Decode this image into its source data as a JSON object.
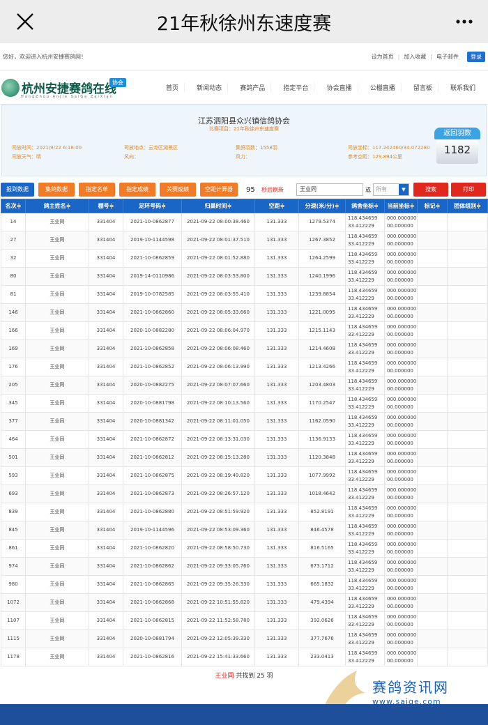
{
  "titlebar": {
    "title": "21年秋徐州东速度赛",
    "close_icon": "close-icon",
    "more_icon": "more-icon"
  },
  "topbar": {
    "greeting": "您好，欢迎进入杭州安捷赛鸽网！",
    "links": [
      "设为首页",
      "加入收藏",
      "电子邮件"
    ],
    "login": "登录"
  },
  "header": {
    "logo_text": "杭州安捷赛鸽在线",
    "logo_badge": "协会",
    "logo_pinyin": "HangZhou AnJie SaiGe ZaiXian",
    "nav": [
      "首页",
      "新闻动态",
      "赛鸽产品",
      "指定平台",
      "协会直播",
      "公棚直播",
      "留言板",
      "联系我们"
    ]
  },
  "panel": {
    "org": "江苏泗阳县众兴镇信鸽协会",
    "project": "比赛项目：21年秋徐州东速度赛",
    "release_time_label": "司放时间：",
    "release_time": "2021/9/22 6:18:00",
    "weather_label": "司放天气：",
    "weather": "晴",
    "location_label": "司放地点：",
    "location": "云龙区湖景区",
    "wind_dir_label": "风向：",
    "wind_dir": "",
    "count_label": "集鸽羽数：",
    "count": "1558羽",
    "wind_label": "风力：",
    "wind": "",
    "coord_label": "司放坐标：",
    "coord": "117.242460/34.072280",
    "dist_label": "参考空距：",
    "dist": "129.894公里",
    "return_label": "返回羽数",
    "return_count": "1182"
  },
  "toolbar": {
    "buttons": [
      "报到数据",
      "集鸽数据",
      "指定名单",
      "指定成绩",
      "关赛成绩",
      "空距计算器"
    ],
    "countdown": "95",
    "refresh": "秒后刷新",
    "search_value": "王业同",
    "or": "或",
    "select_value": "所有",
    "search_button": "搜索",
    "print_button": "打印"
  },
  "table": {
    "headers": [
      "名次",
      "鸽主姓名",
      "棚号",
      "足环号码",
      "归巢时间",
      "空距",
      "分速(米/分)",
      "鸽舍坐标",
      "当前坐标",
      "标记",
      "团体组别"
    ],
    "rows": [
      [
        "14",
        "王业同",
        "331404",
        "2021-10-0862877",
        "2021-09-22 08:00:38.460",
        "131.333",
        "1279.5374"
      ],
      [
        "27",
        "王业同",
        "331404",
        "2019-10-1144598",
        "2021-09-22 08:01:37.510",
        "131.333",
        "1267.3852"
      ],
      [
        "32",
        "王业同",
        "331404",
        "2021-10-0862859",
        "2021-09-22 08:01:52.880",
        "131.333",
        "1264.2599"
      ],
      [
        "80",
        "王业同",
        "331404",
        "2019-14-0110986",
        "2021-09-22 08:03:53.800",
        "131.333",
        "1240.1996"
      ],
      [
        "81",
        "王业同",
        "331404",
        "2019-10-0782585",
        "2021-09-22 08:03:55.410",
        "131.333",
        "1239.8854"
      ],
      [
        "146",
        "王业同",
        "331404",
        "2021-10-0862860",
        "2021-09-22 08:05:33.660",
        "131.333",
        "1221.0095"
      ],
      [
        "166",
        "王业同",
        "331404",
        "2020-10-0882280",
        "2021-09-22 08:06:04.970",
        "131.333",
        "1215.1143"
      ],
      [
        "169",
        "王业同",
        "331404",
        "2021-10-0862858",
        "2021-09-22 08:06:08.460",
        "131.333",
        "1214.4608"
      ],
      [
        "176",
        "王业同",
        "331404",
        "2021-10-0862852",
        "2021-09-22 08:06:13.990",
        "131.333",
        "1213.4266"
      ],
      [
        "205",
        "王业同",
        "331404",
        "2020-10-0882275",
        "2021-09-22 08:07:07.660",
        "131.333",
        "1203.4803"
      ],
      [
        "345",
        "王业同",
        "331404",
        "2020-10-0881798",
        "2021-09-22 08:10:13.560",
        "131.333",
        "1170.2547"
      ],
      [
        "377",
        "王业同",
        "331404",
        "2020-10-0881342",
        "2021-09-22 08:11:01.050",
        "131.333",
        "1162.0590"
      ],
      [
        "464",
        "王业同",
        "331404",
        "2021-10-0862872",
        "2021-09-22 08:13:31.030",
        "131.333",
        "1136.9133"
      ],
      [
        "501",
        "王业同",
        "331404",
        "2021-10-0862812",
        "2021-09-22 08:15:13.280",
        "131.333",
        "1120.3848"
      ],
      [
        "593",
        "王业同",
        "331404",
        "2021-10-0862875",
        "2021-09-22 08:19:49.820",
        "131.333",
        "1077.9992"
      ],
      [
        "693",
        "王业同",
        "331404",
        "2021-10-0862873",
        "2021-09-22 08:26:57.120",
        "131.333",
        "1018.4642"
      ],
      [
        "839",
        "王业同",
        "331404",
        "2021-10-0862880",
        "2021-09-22 08:51:59.920",
        "131.333",
        "852.8191"
      ],
      [
        "845",
        "王业同",
        "331404",
        "2019-10-1144596",
        "2021-09-22 08:53:09.360",
        "131.333",
        "846.4578"
      ],
      [
        "861",
        "王业同",
        "331404",
        "2021-10-0862820",
        "2021-09-22 08:58:50.730",
        "131.333",
        "816.5165"
      ],
      [
        "974",
        "王业同",
        "331404",
        "2021-10-0862862",
        "2021-09-22 09:33:05.760",
        "131.333",
        "673.1712"
      ],
      [
        "980",
        "王业同",
        "331404",
        "2021-10-0862865",
        "2021-09-22 09:35:26.330",
        "131.333",
        "665.1832"
      ],
      [
        "1072",
        "王业同",
        "331404",
        "2021-10-0862868",
        "2021-09-22 10:51:55.820",
        "131.333",
        "479.4394"
      ],
      [
        "1107",
        "王业同",
        "331404",
        "2021-10-0862815",
        "2021-09-22 11:52:58.780",
        "131.333",
        "392.0626"
      ],
      [
        "1115",
        "王业同",
        "331404",
        "2020-10-0881794",
        "2021-09-22 12:05:39.330",
        "131.333",
        "377.7676"
      ],
      [
        "1178",
        "王业同",
        "331404",
        "2021-10-0862816",
        "2021-09-22 15:41:33.660",
        "131.333",
        "233.0413"
      ]
    ],
    "loft_coord": [
      "118.434659",
      "33.412229"
    ],
    "current_coord": [
      "000.000000",
      "00.000000"
    ]
  },
  "footer": {
    "owner": "王业同",
    "summary": " 共找到 25 羽"
  },
  "watermark": {
    "brand": "赛鸽资讯网",
    "url": "www.saige.com"
  }
}
